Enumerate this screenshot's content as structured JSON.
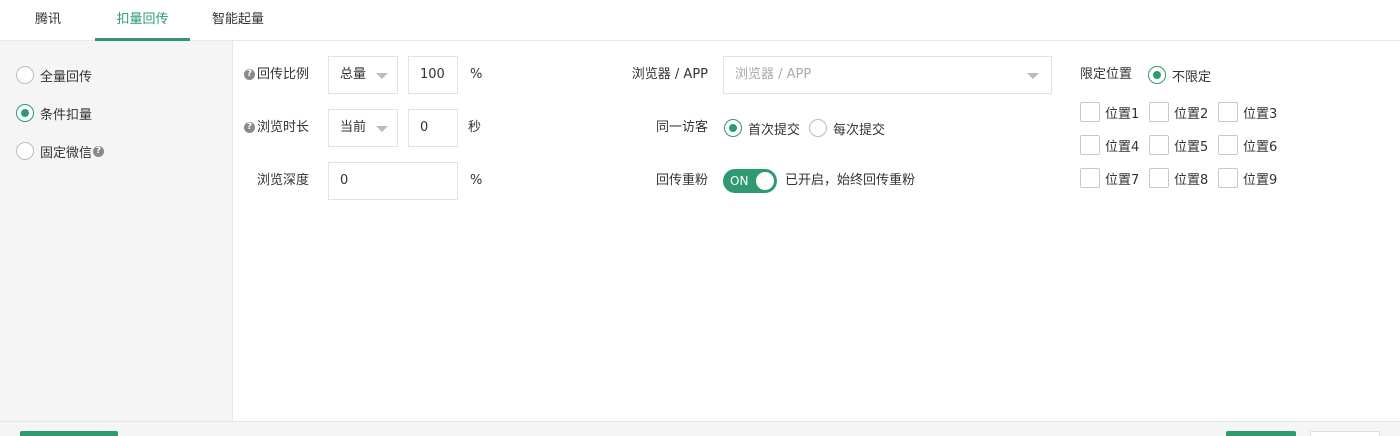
{
  "tabs": [
    {
      "label": "腾讯"
    },
    {
      "label": "扣量回传"
    },
    {
      "label": "智能起量"
    }
  ],
  "active_tab": "扣量回传",
  "mode_options": [
    {
      "label": "全量回传",
      "selected": false
    },
    {
      "label": "条件扣量",
      "selected": true
    },
    {
      "label": "固定微信",
      "selected": false
    }
  ],
  "form": {
    "return_ratio": {
      "label": "回传比例",
      "select": "总量",
      "value": "100",
      "unit": "%"
    },
    "browse_duration": {
      "label": "浏览时长",
      "select": "当前",
      "value": "0",
      "unit": "秒"
    },
    "browse_depth": {
      "label": "浏览深度",
      "value": "0",
      "unit": "%"
    },
    "browser_app": {
      "label": "浏览器 / APP",
      "placeholder": "浏览器 / APP"
    },
    "same_visitor": {
      "label": "同一访客",
      "options": [
        {
          "label": "首次提交",
          "selected": true
        },
        {
          "label": "每次提交",
          "selected": false
        }
      ]
    },
    "repeat_fans": {
      "label": "回传重粉",
      "toggle_text": "ON",
      "toggle_on": true,
      "status_text": "已开启，始终回传重粉"
    },
    "position_limit": {
      "label": "限定位置",
      "unlimited_label": "不限定",
      "unlimited_selected": true,
      "positions": [
        {
          "label": "位置1"
        },
        {
          "label": "位置2"
        },
        {
          "label": "位置3"
        },
        {
          "label": "位置4"
        },
        {
          "label": "位置5"
        },
        {
          "label": "位置6"
        },
        {
          "label": "位置7"
        },
        {
          "label": "位置8"
        },
        {
          "label": "位置9"
        }
      ]
    }
  },
  "help_glyph": "?",
  "colors": {
    "accent": "#2f9a6f",
    "panel_bg": "#f5f5f5"
  }
}
